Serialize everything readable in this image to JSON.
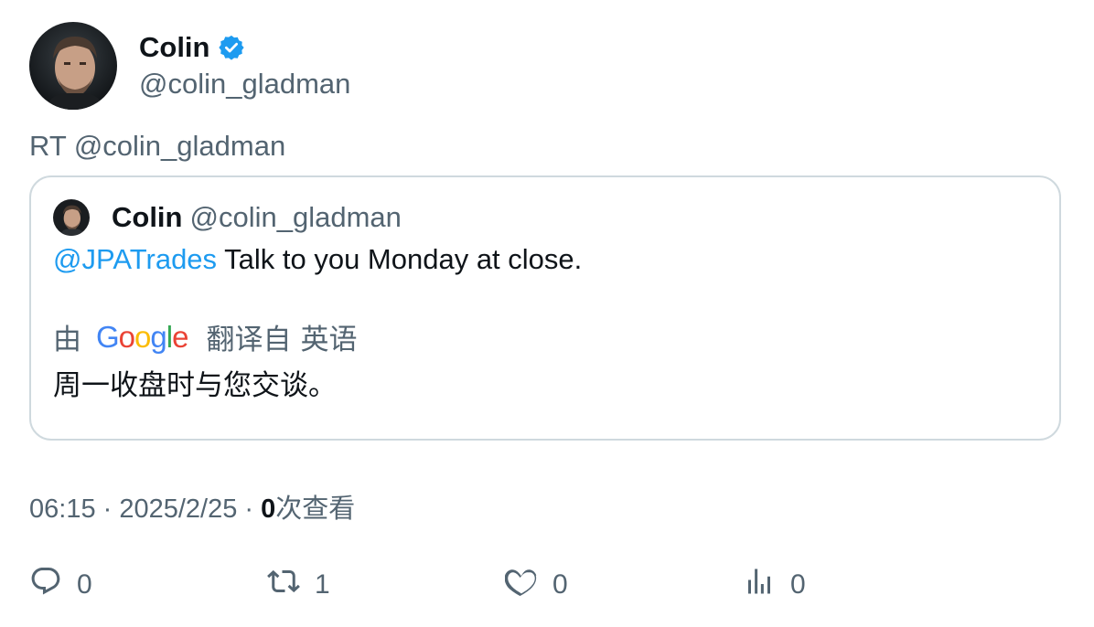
{
  "author": {
    "display_name": "Colin",
    "handle": "@colin_gladman",
    "verified": true
  },
  "retweet_line": "RT @colin_gladman",
  "quote": {
    "display_name": "Colin",
    "handle": "@colin_gladman",
    "mention": "@JPATrades",
    "text": " Talk to you Monday at close.",
    "translation": {
      "prefix": "由",
      "provider": "Google",
      "suffix": "翻译自",
      "language": "英语",
      "text": "周一收盘时与您交谈。"
    }
  },
  "meta": {
    "time": "06:15",
    "separator": " · ",
    "date": "2025/2/25",
    "views_count": "0",
    "views_label": "次查看"
  },
  "actions": {
    "replies": "0",
    "retweets": "1",
    "likes": "0",
    "views": "0"
  },
  "colors": {
    "accent": "#1d9bf0",
    "text": "#0f1419",
    "secondary": "#536471",
    "border": "#cfd9de"
  },
  "icons": [
    "verified-badge-icon",
    "reply-icon",
    "retweet-icon",
    "like-icon",
    "views-icon"
  ]
}
